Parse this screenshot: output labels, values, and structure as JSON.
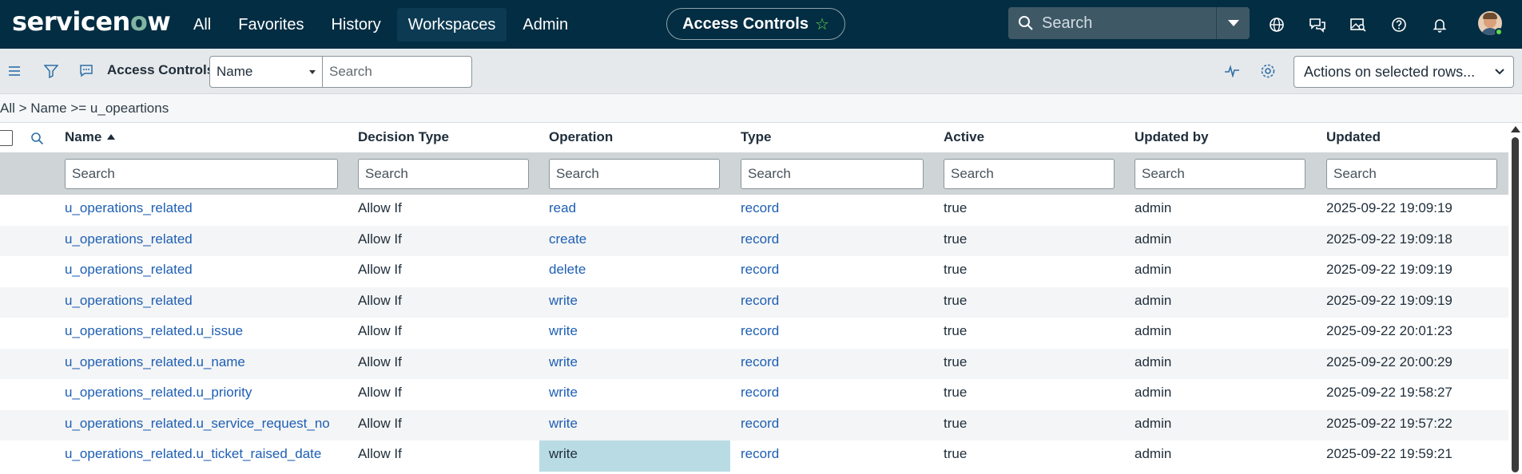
{
  "nav": {
    "logo_before": "servicen",
    "logo_o": "o",
    "logo_after": "w",
    "links": [
      "All",
      "Favorites",
      "History",
      "Workspaces",
      "Admin"
    ],
    "page_title": "Access Controls",
    "search_placeholder": "Search",
    "icons": [
      "globe-icon",
      "chat-icon",
      "image-search-icon",
      "help-icon",
      "bell-icon"
    ]
  },
  "listbar": {
    "title": "Access Controls",
    "field_select": "Name",
    "search_placeholder": "Search",
    "actions": "Actions on selected rows..."
  },
  "breadcrumb": "All > Name >= u_opeartions",
  "table": {
    "columns": [
      "Name",
      "Decision Type",
      "Operation",
      "Type",
      "Active",
      "Updated by",
      "Updated"
    ],
    "filter_placeholder": "Search",
    "rows": [
      [
        "u_operations_related",
        "Allow If",
        "read",
        "record",
        "true",
        "admin",
        "2025-09-22 19:09:19"
      ],
      [
        "u_operations_related",
        "Allow If",
        "create",
        "record",
        "true",
        "admin",
        "2025-09-22 19:09:18"
      ],
      [
        "u_operations_related",
        "Allow If",
        "delete",
        "record",
        "true",
        "admin",
        "2025-09-22 19:09:19"
      ],
      [
        "u_operations_related",
        "Allow If",
        "write",
        "record",
        "true",
        "admin",
        "2025-09-22 19:09:19"
      ],
      [
        "u_operations_related.u_issue",
        "Allow If",
        "write",
        "record",
        "true",
        "admin",
        "2025-09-22 20:01:23"
      ],
      [
        "u_operations_related.u_name",
        "Allow If",
        "write",
        "record",
        "true",
        "admin",
        "2025-09-22 20:00:29"
      ],
      [
        "u_operations_related.u_priority",
        "Allow If",
        "write",
        "record",
        "true",
        "admin",
        "2025-09-22 19:58:27"
      ],
      [
        "u_operations_related.u_service_request_no",
        "Allow If",
        "write",
        "record",
        "true",
        "admin",
        "2025-09-22 19:57:22"
      ],
      [
        "u_operations_related.u_ticket_raised_date",
        "Allow If",
        "write",
        "record",
        "true",
        "admin",
        "2025-09-22 19:59:21"
      ]
    ]
  },
  "colors": {
    "nav_bg": "#032d42",
    "link": "#1e5fb4",
    "favorite_star": "#62d84e",
    "highlight_cell": "#b9dce4"
  }
}
